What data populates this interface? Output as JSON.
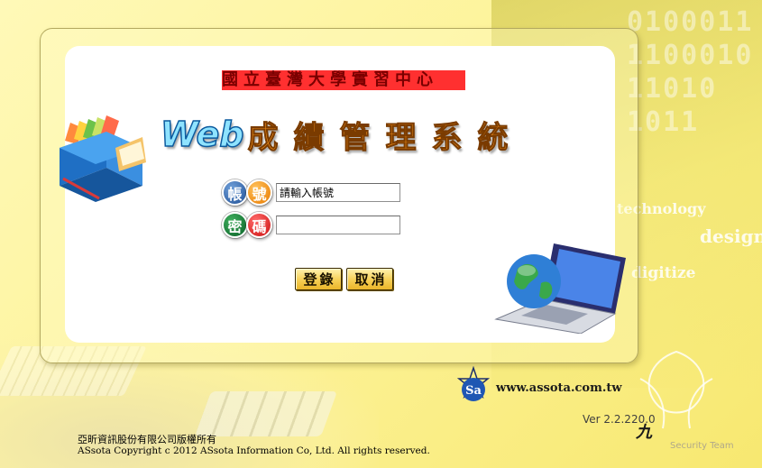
{
  "header": {
    "school_name": "國立臺灣大學實習中心",
    "title_web": "Web",
    "title_cn": "成績管理系統"
  },
  "login": {
    "account_badge_chars": [
      "帳",
      "號"
    ],
    "password_badge_chars": [
      "密",
      "碼"
    ],
    "account_value": "請輸入帳號",
    "password_value": "",
    "login_button": "登錄",
    "cancel_button": "取消"
  },
  "background": {
    "binary_text": "0100011\n1100010\n11010\n1011",
    "words": [
      "technology",
      "design",
      "digitize"
    ]
  },
  "footer": {
    "website": "www.assota.com.tw",
    "version": "Ver 2.2.220.0",
    "security_team": "Security Team",
    "company_cn": "亞昕資訊股份有限公司版權所有",
    "copyright_en": "ASsota Copyright c 2012 ASsota Information Co, Ltd. All rights reserved."
  },
  "colors": {
    "background": "#fdf39a",
    "title_orange": "#ff9a1f",
    "button": "#f6cf55",
    "redacted_bar": "#ff3030"
  }
}
